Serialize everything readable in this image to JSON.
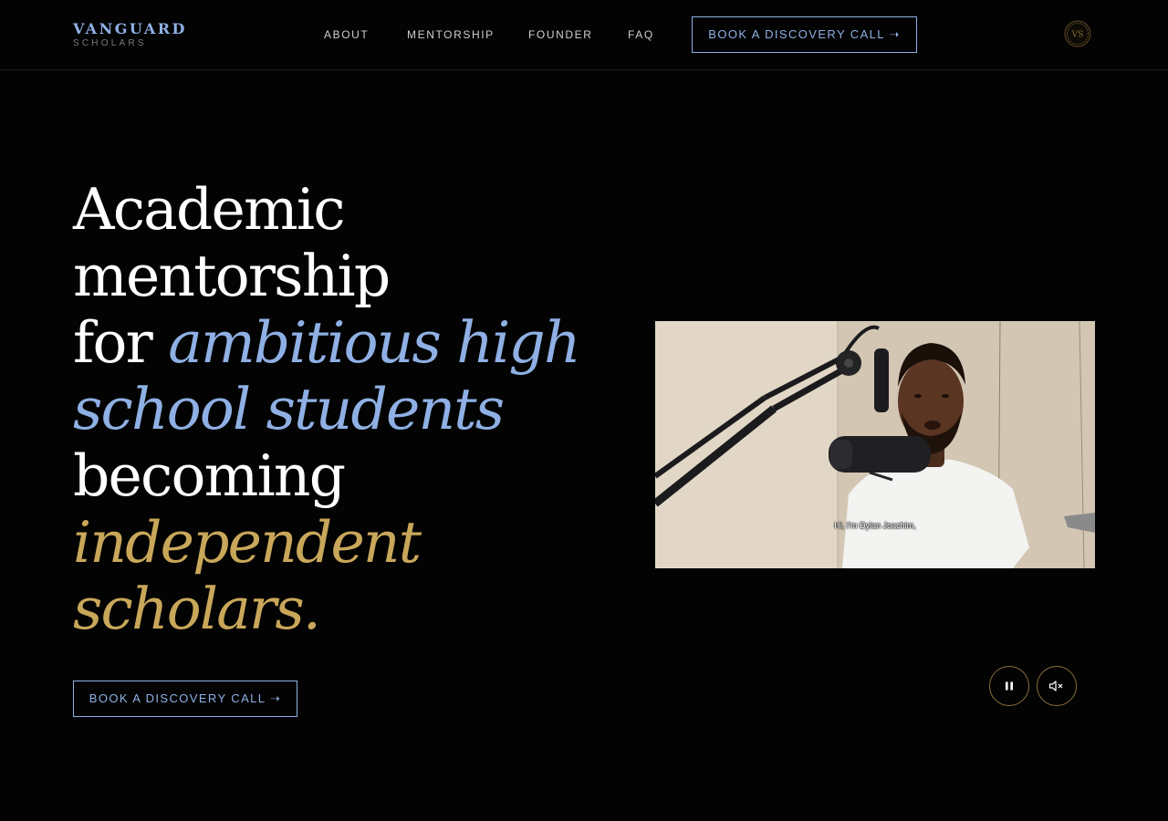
{
  "brand": {
    "name": "VANGUARD",
    "tagline": "SCHOLARS",
    "seal_text": "VS"
  },
  "nav": {
    "items": [
      {
        "label": "ABOUT"
      },
      {
        "label": "MENTORSHIP"
      },
      {
        "label": "FOUNDER"
      },
      {
        "label": "FAQ"
      }
    ],
    "cta_label": "BOOK A DISCOVERY CALL ➝"
  },
  "hero": {
    "lines": [
      "Academic",
      "mentorship",
      "for ",
      "ambitious high",
      "school students",
      "becoming",
      "independent",
      "scholars."
    ],
    "cta_label": "BOOK A DISCOVERY CALL ➝"
  },
  "video": {
    "caption": "Hi, I'm Dylan Joachim,",
    "controls": {
      "pause_icon": "pause-icon",
      "mute_icon": "volume-muted-icon"
    }
  },
  "colors": {
    "background": "#030303",
    "accent_blue": "#8fb0e4",
    "accent_gold": "#c9a75a"
  }
}
